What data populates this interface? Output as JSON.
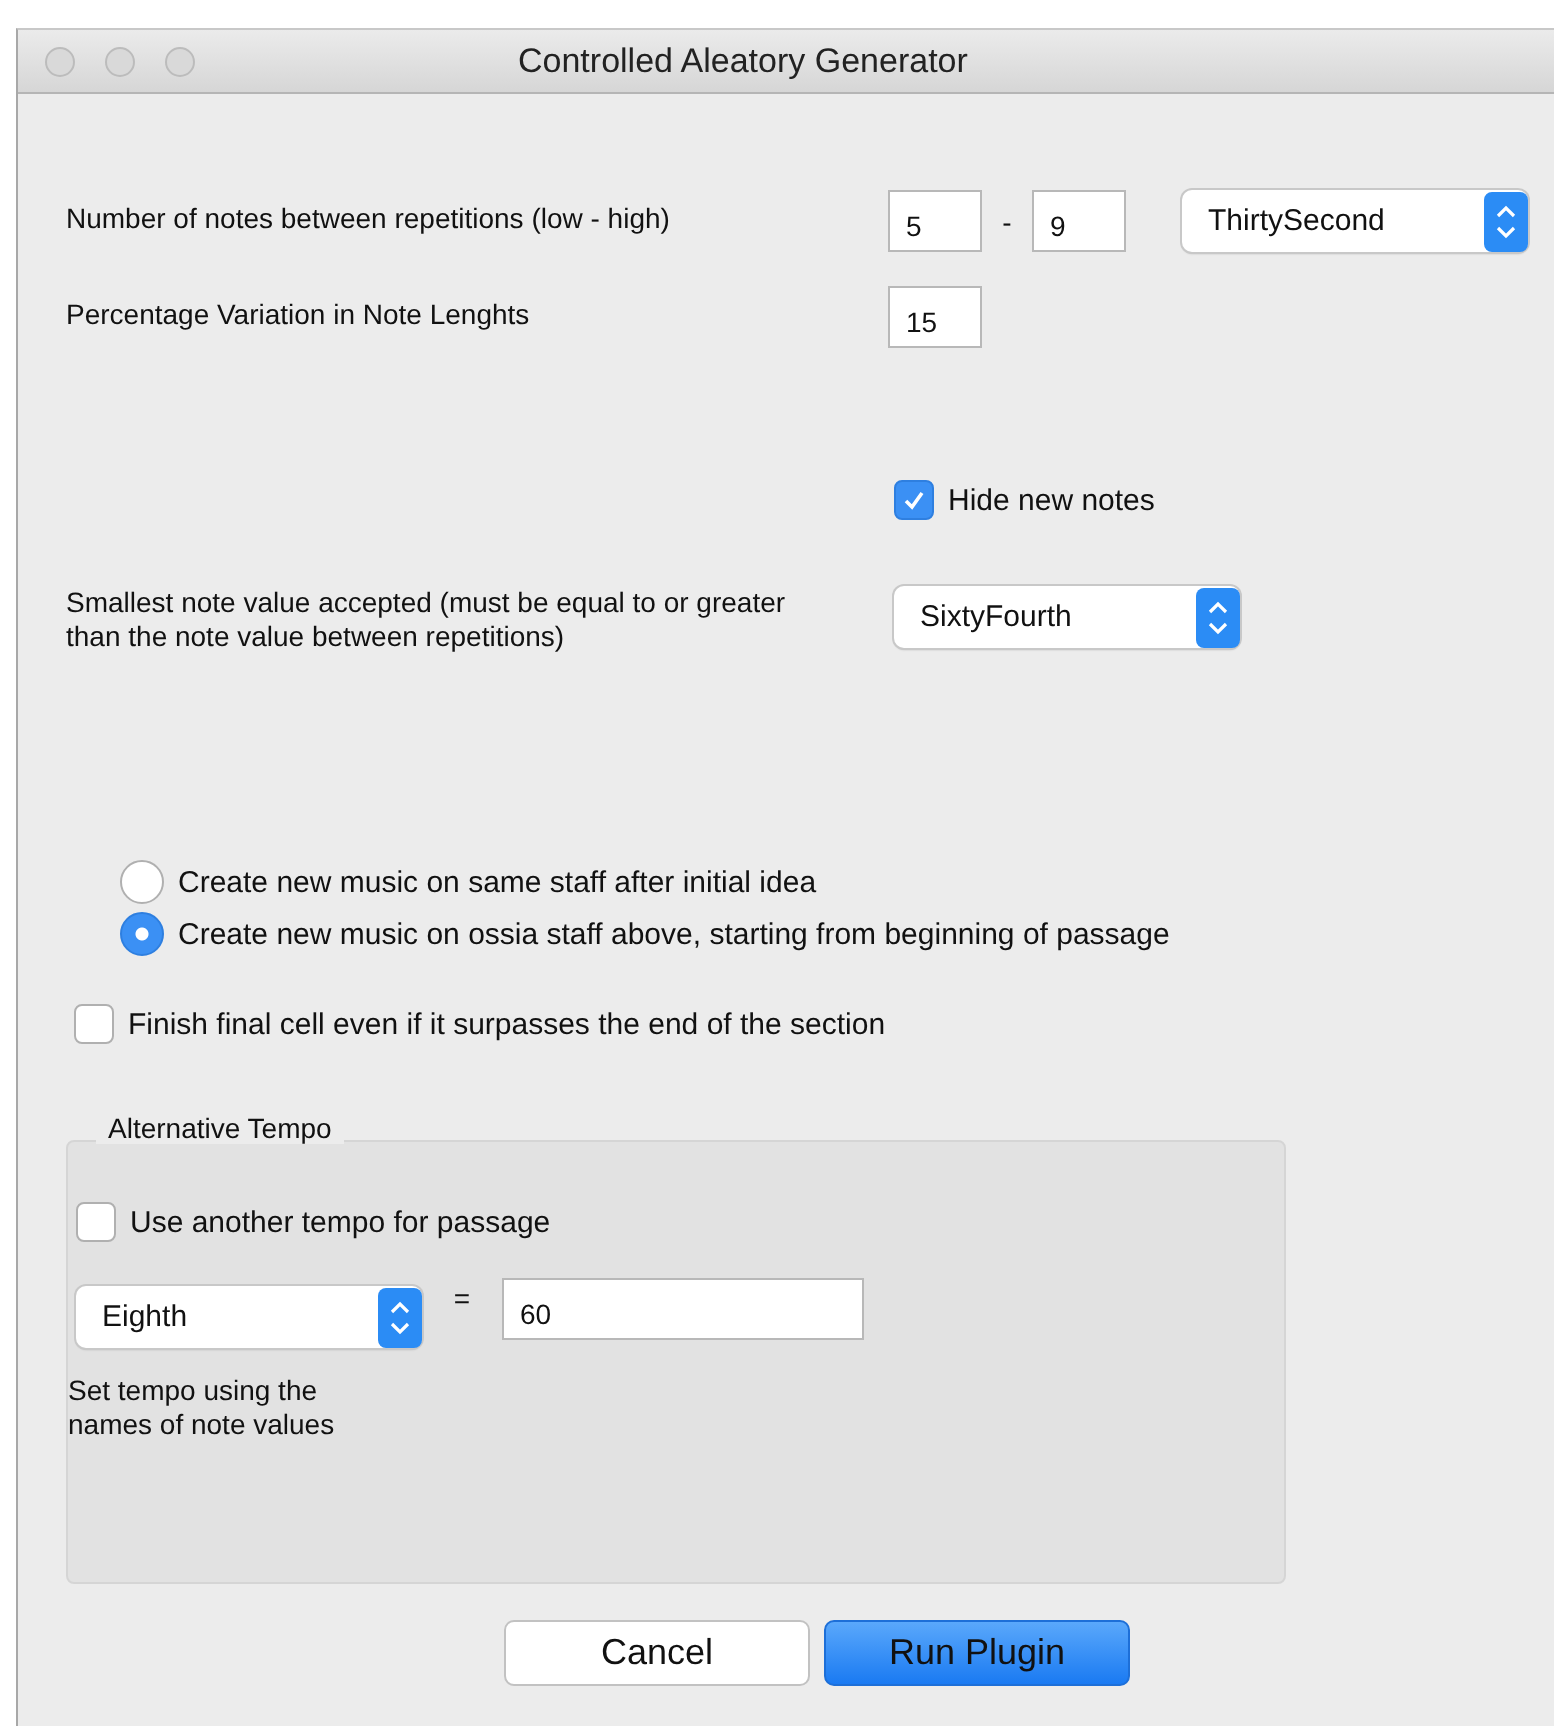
{
  "window": {
    "title": "Controlled Aleatory Generator"
  },
  "repetitions": {
    "label": "Number of notes between repetitions (low - high)",
    "low": "5",
    "separator": "-",
    "high": "9",
    "note_value": "ThirtySecond"
  },
  "variation": {
    "label": "Percentage Variation in Note Lenghts",
    "value": "15"
  },
  "hide_new_notes": {
    "label": "Hide new notes",
    "checked": true
  },
  "smallest": {
    "label": "Smallest note value accepted (must be equal to or greater than the note value between repetitions)",
    "value": "SixtyFourth"
  },
  "placement": [
    {
      "label": "Create new music on same staff after initial idea",
      "selected": false
    },
    {
      "label": "Create new music on ossia staff above, starting from beginning of passage",
      "selected": true
    }
  ],
  "finish_cell": {
    "label": "Finish final cell even if it surpasses the end of the section",
    "checked": false
  },
  "alternative_tempo": {
    "title": "Alternative Tempo",
    "use": {
      "label": "Use another tempo for passage",
      "checked": false
    },
    "note_value": "Eighth",
    "equals": "=",
    "bpm": "60",
    "hint": "Set tempo using the names of note values"
  },
  "buttons": [
    {
      "label": "Cancel",
      "kind": "secondary"
    },
    {
      "label": "Run Plugin",
      "kind": "primary"
    }
  ]
}
